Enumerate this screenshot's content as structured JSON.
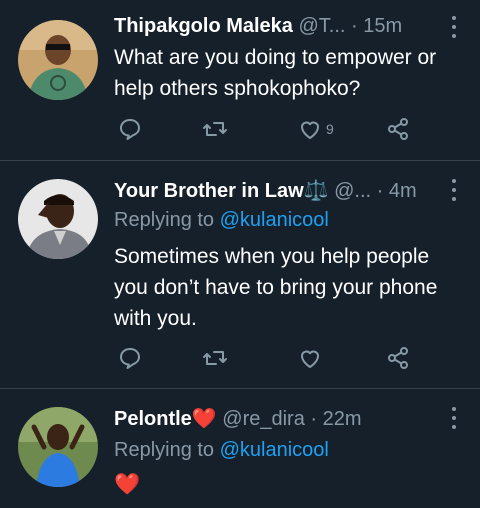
{
  "tweets": [
    {
      "name": "Thipakgolo Maleka",
      "handle": "@T...",
      "time": "· 15m",
      "text": "What are you doing to empower or help others sphokophoko?",
      "like_count": "9"
    },
    {
      "name": "Your Brother in Law",
      "name_emoji": "⚖️",
      "handle": "@...",
      "time": "· 4m",
      "replying_prefix": "Replying to",
      "replying_to": "@kulanicool",
      "text": "Sometimes when you help people you don’t have to bring your phone with you."
    },
    {
      "name": "Pelontle",
      "name_emoji": "❤️",
      "handle": "@re_dira",
      "time": "· 22m",
      "replying_prefix": "Replying to",
      "replying_to": "@kulanicool",
      "text": "❤️"
    }
  ],
  "icons": [
    "reply-icon",
    "retweet-icon",
    "like-icon",
    "share-icon",
    "more-icon"
  ],
  "colors": {
    "background": "#15202b",
    "muted": "#8899a6",
    "link": "#1da1f2",
    "divider": "#38444d"
  }
}
